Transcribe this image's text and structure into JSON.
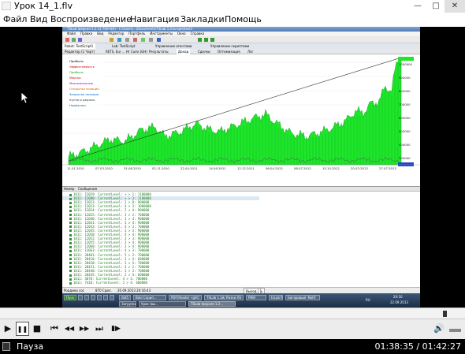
{
  "window": {
    "title": "Урок 14_1.flv",
    "minimize": "—",
    "maximize": "□",
    "close": "✕"
  },
  "menu": [
    "Файл",
    "Вид",
    "Воспроизведение",
    "Навигация",
    "Закладки",
    "Помощь"
  ],
  "inner": {
    "title": "TSLab (версия 1.2.11.700-tk6) - C:\\Users\\...\\Documents\\TSLab 1.2\\scripts\\test1",
    "menu": [
      "Файл",
      "Правка",
      "Вид",
      "Редактор",
      "Портфель",
      "Инструменты",
      "Окно",
      "Справка"
    ],
    "tabs": [
      "Robot: TestScript1",
      "Lab: TestScript",
      "Управление агентами",
      "Управление скриптами"
    ],
    "subtabs": [
      "Редактор (1 Чарт)",
      "RETS, Eur ... Hr Cumr.(GH)",
      "Результаты",
      "Доход",
      "Сделки",
      "Оптимизация",
      "Лог"
    ],
    "legend": [
      "Прибыль",
      "Эффективность",
      "Прибыль",
      "Убытки",
      "Максимальные",
      "Открытая позиция",
      "Закрытая позиция",
      "Купля и держка",
      "Надёжная"
    ],
    "dates": [
      "11.01.2010",
      "07.03.2010",
      "31.08.2010",
      "02.11.2010",
      "22.04.2011",
      "14.09.2011",
      "12.12.2011",
      "06.04.2012",
      "08.07.2012",
      "15.10.2012",
      "20.03.2013",
      "27.07.2013"
    ],
    "yvals": [
      "1000000",
      "900000",
      "800000",
      "700000",
      "600000",
      "500000",
      "400000",
      "300000"
    ],
    "log": {
      "headers": [
        "Номер",
        "Сообщения"
      ],
      "rows": [
        "1011: 12019: CurrentLevel: + > 1: 1100000",
        "1011: 12000: CurrentLevel: + > 3: 1100000",
        "1011: 12021: CurrentLevel: 2 > 0: 900000",
        "1011: 12023: CurrentLevel: 4 > 3: 1000000",
        "1011: 12024: CurrentLevel: 2 > 4: 900000",
        "1011: 12025: CurrentLevel: 3 > 2: 700000",
        "1011: 12040: CurrentLevel: 3 > 4: 900000",
        "1011: 12041: CurrentLevel: 3 > 4: 900000",
        "1011: 12043: CurrentLevel: 4 > 3: 700000",
        "1011: 12045: CurrentLevel: 3 > 3: 900000",
        "1011: 12050: CurrentLevel: 4 > 4: 900000",
        "1011: 12052: CurrentLevel: 3 > 3: 900000",
        "1011: 12055: CurrentLevel: 3 > 4: 900000",
        "1011: 12060: CurrentLevel: 3 > 4: 900000",
        "1011: 12063: CurrentLevel: 4 > 3: 700000",
        "1011: 20401: CurrentLevel: 5 > 3: 700000",
        "1011: 20410: CurrentLevel: 3 > 4: 600000",
        "1011: 20420: CurrentLevel: 2 > 3: 700000",
        "1011: 20431: CurrentLevel: 4 > 2: 700000",
        "1011: 20440: CurrentLevel: 3 > 3: 700000",
        "1011: 20445: CurrentLevel: 2 > 4: 600000",
        "1011: 4870: CurrentLevel: 4 > 3: 700000",
        "1011: 7410: CurrentLevel: 2 > 4: 600000"
      ]
    },
    "statusbar": {
      "left": "Роадина сос",
      "count": "870 Сдел.",
      "time": "20.09.2013 20:16:43",
      "btabs": [
        "Портфель",
        "Б",
        "В",
        "ЕнеЧ",
        "ОсиЧиб",
        "Выход ОИЬ"
      ]
    },
    "taskbar": {
      "start": "Пуск",
      "items": [
        "dat5",
        "Bolo Скрип...",
        "PDF[Reader -ight]",
        "TSLab 1.2й; Ризки Ля",
        "PIKH",
        "tsLab Рост",
        "Загрузки",
        "Урок (вы...",
        "TSLab (версия 1.2...",
        "Бигоровый -Notif"
      ],
      "lang": "RU",
      "clock_time": "20:16",
      "clock_date": "22.09.2013"
    }
  },
  "player": {
    "state": "Пауза",
    "time": "01:38:35 / 01:42:27",
    "progress": 0.96,
    "controls": {
      "play": "▶",
      "pause": "❚❚",
      "stop": "■",
      "prev": "⏮",
      "rew": "◀◀",
      "fwd": "▶▶",
      "next": "⏭",
      "step": "▮▶",
      "volume": "🔊"
    }
  }
}
